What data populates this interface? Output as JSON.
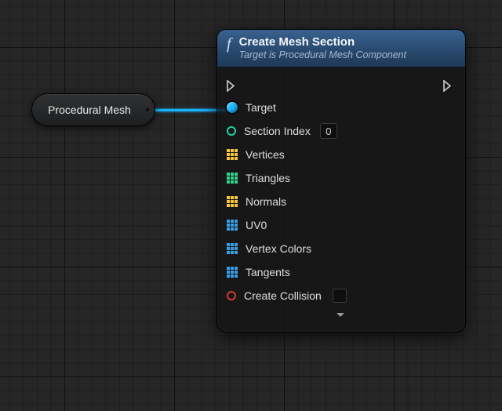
{
  "capsule": {
    "label": "Procedural Mesh"
  },
  "node": {
    "title": "Create Mesh Section",
    "subtitle": "Target is Procedural Mesh Component",
    "pins": {
      "target": "Target",
      "section_index": {
        "label": "Section Index",
        "value": "0"
      },
      "vertices": "Vertices",
      "triangles": "Triangles",
      "normals": "Normals",
      "uv0": "UV0",
      "vertex_colors": "Vertex Colors",
      "tangents": "Tangents",
      "create_collision": "Create Collision"
    }
  }
}
